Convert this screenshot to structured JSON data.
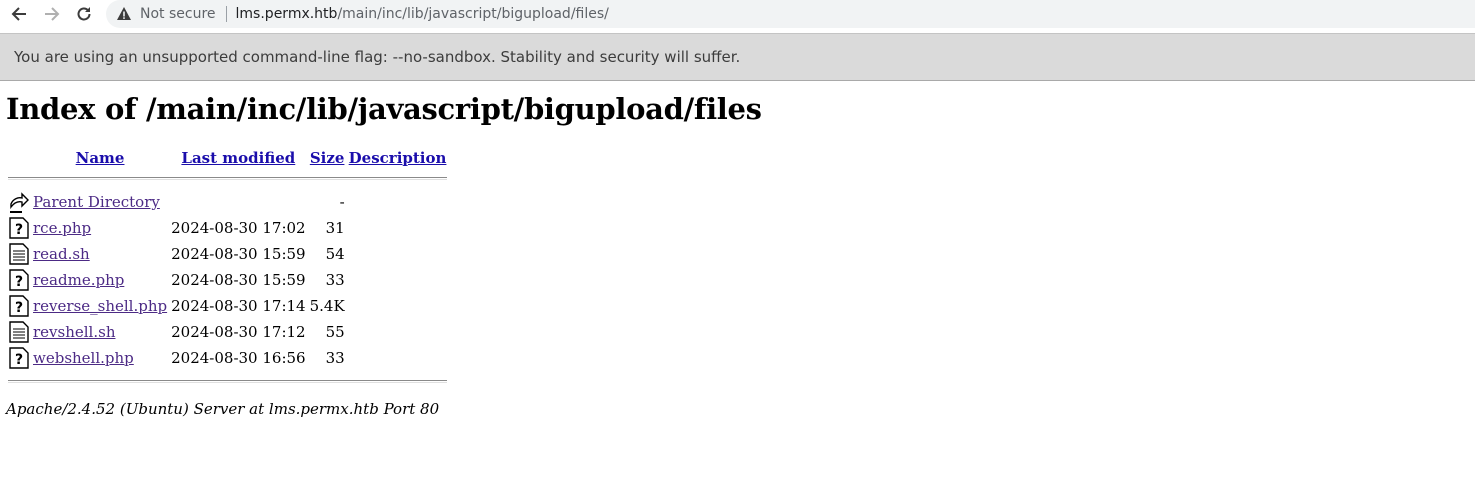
{
  "browser": {
    "security_label": "Not secure",
    "url_host": "lms.permx.htb",
    "url_path": "/main/inc/lib/javascript/bigupload/files/",
    "infobar_text": "You are using an unsupported command-line flag: --no-sandbox. Stability and security will suffer."
  },
  "page": {
    "title": "Index of /main/inc/lib/javascript/bigupload/files",
    "columns": {
      "name": "Name",
      "modified": "Last modified",
      "size": "Size",
      "description": "Description"
    },
    "rows": [
      {
        "icon": "back-icon",
        "name": "Parent Directory",
        "modified": "",
        "size": "-",
        "description": ""
      },
      {
        "icon": "unknown-file-icon",
        "name": "rce.php",
        "modified": "2024-08-30 17:02",
        "size": "31",
        "description": ""
      },
      {
        "icon": "text-file-icon",
        "name": "read.sh",
        "modified": "2024-08-30 15:59",
        "size": "54",
        "description": ""
      },
      {
        "icon": "unknown-file-icon",
        "name": "readme.php",
        "modified": "2024-08-30 15:59",
        "size": "33",
        "description": ""
      },
      {
        "icon": "unknown-file-icon",
        "name": "reverse_shell.php",
        "modified": "2024-08-30 17:14",
        "size": "5.4K",
        "description": ""
      },
      {
        "icon": "text-file-icon",
        "name": "revshell.sh",
        "modified": "2024-08-30 17:12",
        "size": "55",
        "description": ""
      },
      {
        "icon": "unknown-file-icon",
        "name": "webshell.php",
        "modified": "2024-08-30 16:56",
        "size": "33",
        "description": ""
      }
    ],
    "footer": "Apache/2.4.52 (Ubuntu) Server at lms.permx.htb Port 80"
  }
}
